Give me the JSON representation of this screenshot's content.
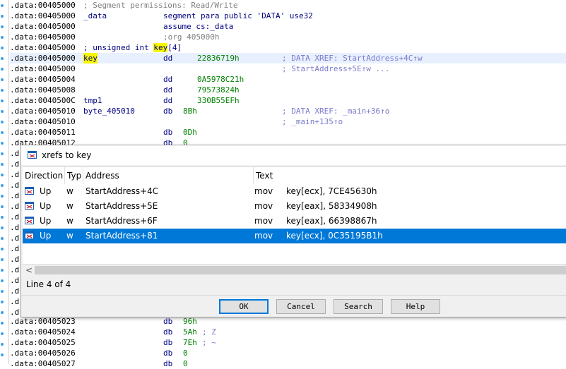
{
  "listing": {
    "rows": [
      {
        "addr": ".data:00405000",
        "label": "",
        "mnem": "",
        "operand": "",
        "comment": "; Segment permissions: Read/Write",
        "commentStyle": "gray"
      },
      {
        "addr": ".data:00405000",
        "label": "_data",
        "mnem": "segment para public 'DATA' use32",
        "operand": "",
        "comment": ""
      },
      {
        "addr": ".data:00405000",
        "label": "",
        "mnem": "assume cs:_data",
        "operand": "",
        "comment": ""
      },
      {
        "addr": ".data:00405000",
        "label": "",
        "mnem": ";org 405000h",
        "operand": "",
        "comment": "",
        "mnemStyle": "gray"
      },
      {
        "addr": ".data:00405000",
        "label": "; unsigned int key[4]",
        "mnem": "",
        "operand": "",
        "comment": ""
      },
      {
        "addr": ".data:00405000",
        "label": "key",
        "mnem": "dd",
        "operand": "22836719h",
        "comment": "; DATA XREF: StartAddress+4C↑w",
        "highlight": true
      },
      {
        "addr": ".data:00405000",
        "label": "",
        "mnem": "",
        "operand": "",
        "comment": "; StartAddress+5E↑w ..."
      },
      {
        "addr": ".data:00405004",
        "label": "",
        "mnem": "dd",
        "operand": "0A5978C21h",
        "comment": ""
      },
      {
        "addr": ".data:00405008",
        "label": "",
        "mnem": "dd",
        "operand": "79573824h",
        "comment": ""
      },
      {
        "addr": ".data:0040500C",
        "label": "tmp1",
        "mnem": "dd",
        "operand": "330B55EFh",
        "comment": ""
      },
      {
        "addr": ".data:00405010",
        "label": "byte_405010",
        "mnem": "db",
        "operand": "8Bh",
        "comment": "; DATA XREF: _main+36↑o"
      },
      {
        "addr": ".data:00405010",
        "label": "",
        "mnem": "",
        "operand": "",
        "comment": "; _main+135↑o"
      },
      {
        "addr": ".data:00405011",
        "label": "",
        "mnem": "db",
        "operand": "0Dh",
        "comment": ""
      },
      {
        "addr": ".data:00405012",
        "label": "",
        "mnem": "db",
        "operand": "0",
        "comment": ""
      }
    ],
    "bottom_rows": [
      {
        "addr": ".data:00405023",
        "label": "",
        "mnem": "db",
        "operand": "96h",
        "comment": ""
      },
      {
        "addr": ".data:00405024",
        "label": "",
        "mnem": "db",
        "operand": "5Ah",
        "comment": "; Z"
      },
      {
        "addr": ".data:00405025",
        "label": "",
        "mnem": "db",
        "operand": "7Eh",
        "comment": "; ~"
      },
      {
        "addr": ".data:00405026",
        "label": "",
        "mnem": "db",
        "operand": "0",
        "comment": ""
      },
      {
        "addr": ".data:00405027",
        "label": "",
        "mnem": "db",
        "operand": "0",
        "comment": ""
      }
    ],
    "hidden_prefix": ".d"
  },
  "dialog": {
    "title": "xrefs to key",
    "columns": [
      "Direction",
      "Typ",
      "Address",
      "Text"
    ],
    "rows": [
      {
        "direction": "Up",
        "type": "w",
        "address": "StartAddress+4C",
        "mnem": "mov",
        "operand": "key[ecx], 7CE45630h"
      },
      {
        "direction": "Up",
        "type": "w",
        "address": "StartAddress+5E",
        "mnem": "mov",
        "operand": "key[eax], 58334908h"
      },
      {
        "direction": "Up",
        "type": "w",
        "address": "StartAddress+6F",
        "mnem": "mov",
        "operand": "key[eax], 66398867h"
      },
      {
        "direction": "Up",
        "type": "w",
        "address": "StartAddress+81",
        "mnem": "mov",
        "operand": "key[ecx], 0C35195B1h",
        "selected": true
      }
    ],
    "scroll_left": "<",
    "status": "Line 4 of 4",
    "buttons": {
      "ok": "OK",
      "cancel": "Cancel",
      "search": "Search",
      "help": "Help"
    }
  },
  "colors": {
    "selection": "#0078d7",
    "label_highlight": "#f7f700",
    "gutter_dot": "#3aa0e8"
  },
  "icons": {
    "title": "xref-window-icon",
    "row": "xref-row-icon"
  }
}
